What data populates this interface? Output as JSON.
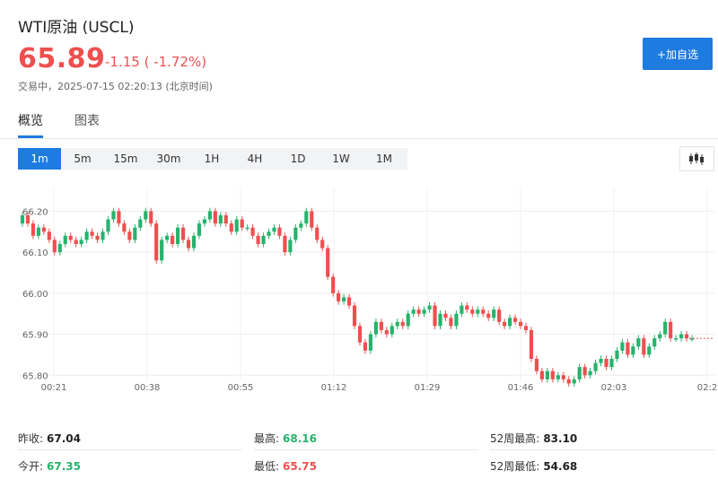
{
  "header": {
    "title": "WTI原油 (USCL)",
    "price": "65.89",
    "change": "-1.15 ( -1.72%)",
    "status": "交易中，2025-07-15 02:20:13 (北京时间)",
    "add_watchlist": "+加自选"
  },
  "tabs": [
    {
      "label": "概览",
      "active": true
    },
    {
      "label": "图表",
      "active": false
    }
  ],
  "intervals": [
    {
      "label": "1m",
      "active": true
    },
    {
      "label": "5m",
      "active": false
    },
    {
      "label": "15m",
      "active": false
    },
    {
      "label": "30m",
      "active": false
    },
    {
      "label": "1H",
      "active": false
    },
    {
      "label": "4H",
      "active": false
    },
    {
      "label": "1D",
      "active": false
    },
    {
      "label": "1W",
      "active": false
    },
    {
      "label": "1M",
      "active": false
    }
  ],
  "colors": {
    "up": "#26b36c",
    "down": "#ee4f4f",
    "accent": "#1e7be0"
  },
  "stats": [
    {
      "label": "昨收:",
      "value": "67.04",
      "color": "#222222"
    },
    {
      "label": "最高:",
      "value": "68.16",
      "color": "#26b36c"
    },
    {
      "label": "52周最高:",
      "value": "83.10",
      "color": "#222222"
    },
    {
      "label": "今开:",
      "value": "67.35",
      "color": "#26b36c"
    },
    {
      "label": "最低:",
      "value": "65.75",
      "color": "#ee4f4f"
    },
    {
      "label": "52周最低:",
      "value": "54.68",
      "color": "#222222"
    }
  ],
  "chart_data": {
    "type": "candlestick",
    "title": "",
    "xlabel": "",
    "ylabel": "",
    "ylim": [
      65.77,
      66.26
    ],
    "y_ticks": [
      "66.20",
      "66.10",
      "66.00",
      "65.90",
      "65.80"
    ],
    "x_ticks": [
      "00:21",
      "00:38",
      "00:55",
      "01:12",
      "01:29",
      "01:46",
      "02:03",
      "02:2"
    ],
    "grid": true,
    "close": [
      66.19,
      66.17,
      66.14,
      66.16,
      66.15,
      66.13,
      66.1,
      66.12,
      66.14,
      66.13,
      66.12,
      66.13,
      66.15,
      66.14,
      66.13,
      66.15,
      66.18,
      66.2,
      66.17,
      66.15,
      66.13,
      66.16,
      66.18,
      66.2,
      66.17,
      66.08,
      66.13,
      66.14,
      66.12,
      66.16,
      66.13,
      66.11,
      66.14,
      66.17,
      66.18,
      66.2,
      66.17,
      66.19,
      66.17,
      66.15,
      66.18,
      66.16,
      66.16,
      66.14,
      66.12,
      66.14,
      66.15,
      66.16,
      66.14,
      66.1,
      66.13,
      66.16,
      66.17,
      66.2,
      66.16,
      66.13,
      66.11,
      66.04,
      66.0,
      65.98,
      65.99,
      65.97,
      65.92,
      65.88,
      65.86,
      65.9,
      65.93,
      65.91,
      65.9,
      65.92,
      65.93,
      65.92,
      65.95,
      65.96,
      65.95,
      65.96,
      65.97,
      65.92,
      65.95,
      65.94,
      65.92,
      65.95,
      65.97,
      65.96,
      65.95,
      65.96,
      65.95,
      65.94,
      65.96,
      65.93,
      65.92,
      65.94,
      65.93,
      65.92,
      65.91,
      65.84,
      65.81,
      65.79,
      65.81,
      65.79,
      65.8,
      65.79,
      65.78,
      65.79,
      65.82,
      65.8,
      65.81,
      65.83,
      65.84,
      65.82,
      65.84,
      65.86,
      65.88,
      65.85,
      65.87,
      65.89,
      65.85,
      65.87,
      65.89,
      65.9,
      65.93,
      65.89,
      65.89,
      65.9,
      65.89,
      65.89
    ],
    "start_open": 66.17
  }
}
